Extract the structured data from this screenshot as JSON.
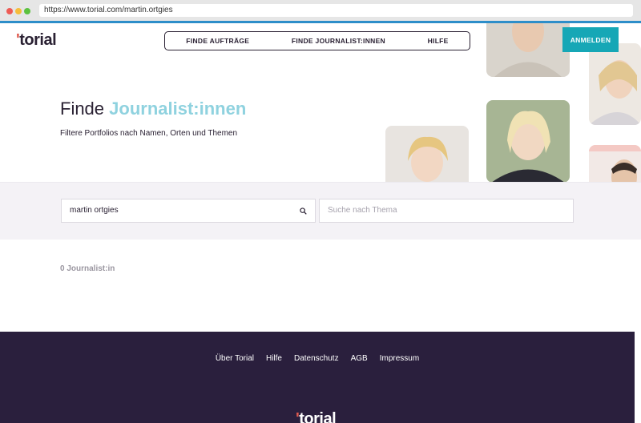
{
  "browser": {
    "url": "https://www.torial.com/martin.ortgies"
  },
  "header": {
    "logo_mark": "'",
    "logo_text": "torial",
    "nav": [
      {
        "label": "FINDE AUFTRÄGE"
      },
      {
        "label": "FINDE JOURNALIST:INNEN"
      },
      {
        "label": "HILFE"
      }
    ],
    "login_label": "ANMELDEN"
  },
  "hero": {
    "title_prefix": "Finde",
    "title_accent": "Journalist:innen",
    "subtitle": "Filtere Portfolios nach Namen, Orten und Themen"
  },
  "search": {
    "name_value": "martin ortgies",
    "topic_placeholder": "Suche nach Thema",
    "search_icon": "search-icon"
  },
  "results": {
    "count_label": "0 Journalist:in"
  },
  "footer": {
    "links": [
      {
        "label": "Über Torial"
      },
      {
        "label": "Hilfe"
      },
      {
        "label": "Datenschutz"
      },
      {
        "label": "AGB"
      },
      {
        "label": "Impressum"
      }
    ],
    "logo_mark": "'",
    "logo_text": "torial"
  },
  "colors": {
    "brand_dark": "#2a2133",
    "accent_teal": "#16a7b6",
    "accent_light": "#8fd2df",
    "logo_tick": "#e05a4e",
    "footer_bg": "#2a1f3d"
  }
}
